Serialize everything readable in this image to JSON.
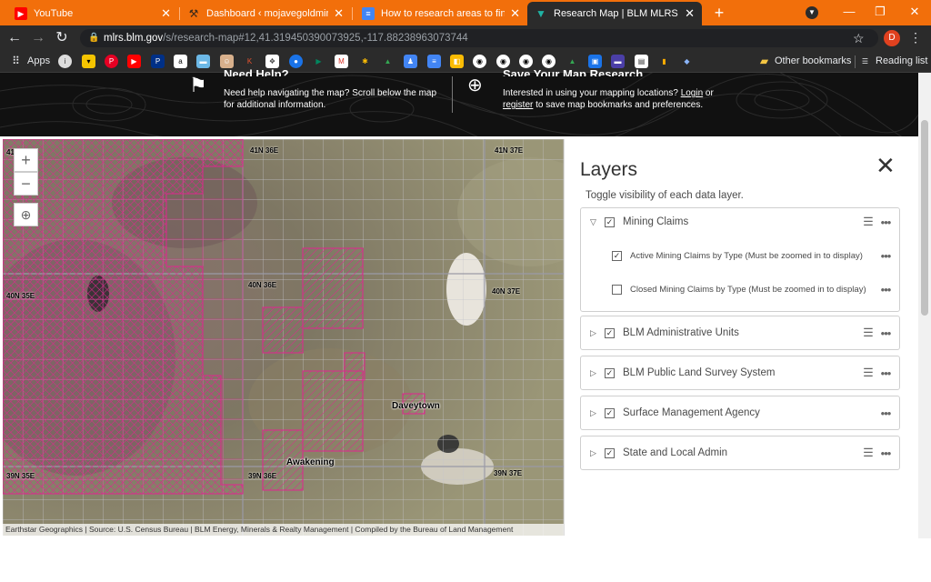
{
  "tabs": [
    {
      "title": "YouTube",
      "icon": "youtube-icon",
      "active": false
    },
    {
      "title": "Dashboard ‹ mojavegoldmining.com",
      "icon": "wordpress-tools-icon",
      "active": false
    },
    {
      "title": "How to research areas to find gold",
      "icon": "google-docs-icon",
      "active": false
    },
    {
      "title": "Research Map | BLM MLRS",
      "icon": "blm-icon",
      "active": true
    }
  ],
  "browser": {
    "new_tab": "+",
    "url_domain": "mlrs.blm.gov",
    "url_path": "/s/research-map#12,41.319450390073925,-117.88238963073744",
    "avatar_letter": "D",
    "apps_label": "Apps",
    "other_bookmarks": "Other bookmarks",
    "reading_list": "Reading list"
  },
  "banner": {
    "help_title": "Need Help?",
    "help_text_1": "Need help navigating the map? Scroll below the map for additional information.",
    "save_title": "Save Your Map Research",
    "save_text_pre": "Interested in using your mapping locations? ",
    "save_login": "Login",
    "save_or": " or ",
    "save_register": "register",
    "save_text_post": " to save map bookmarks and preferences."
  },
  "map": {
    "zoom_in": "+",
    "zoom_out": "−",
    "locate": "⊕",
    "township_labels": [
      "41N 36E",
      "41N 37E",
      "40N 35E",
      "40N 36E",
      "40N 37E",
      "39N 35E",
      "39N 36E",
      "39N 37E",
      "41"
    ],
    "places": [
      "Daveytown",
      "Awakening"
    ],
    "attribution": "Earthstar Geographics | Source: U.S. Census Bureau | BLM Energy, Minerals & Realty Management | Compiled by the Bureau of Land Management"
  },
  "layers_panel": {
    "title": "Layers",
    "description": "Toggle visibility of each data layer.",
    "close": "✕",
    "groups": [
      {
        "label": "Mining Claims",
        "expanded": true,
        "checked": true,
        "has_menu": true,
        "children": [
          {
            "label": "Active Mining Claims by Type (Must be zoomed in to display)",
            "checked": true
          },
          {
            "label": "Closed Mining Claims by Type (Must be zoomed in to display)",
            "checked": false
          }
        ]
      },
      {
        "label": "BLM Administrative Units",
        "checked": true,
        "has_menu": true
      },
      {
        "label": "BLM Public Land Survey System",
        "checked": true,
        "has_menu": true
      },
      {
        "label": "Surface Management Agency",
        "checked": true,
        "has_menu": false
      },
      {
        "label": "State and Local Admin",
        "checked": true,
        "has_menu": true
      }
    ]
  },
  "colors": {
    "tab_bar": "#f26f0b",
    "chrome_dark": "#2b2b2b",
    "claim_magenta": "#e0258f",
    "grid": "#b8b8c0"
  }
}
